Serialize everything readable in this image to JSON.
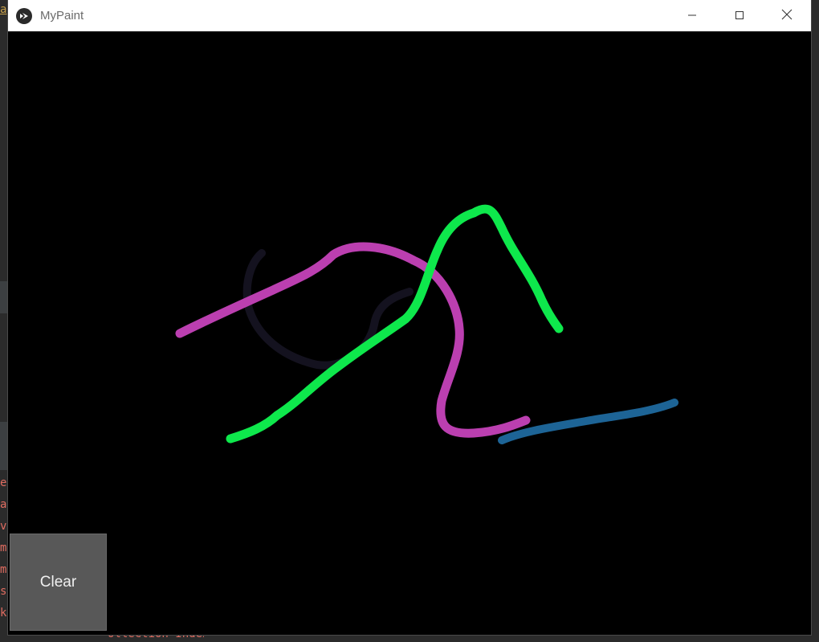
{
  "window": {
    "title": "MyPaint",
    "icon": "kivy-logo-icon"
  },
  "title_bar": {
    "minimize_icon": "minimize-icon",
    "maximize_icon": "maximize-icon",
    "close_icon": "close-icon"
  },
  "canvas": {
    "background": "#000000",
    "strokes": [
      {
        "name": "dark-navy-stroke",
        "color": "#14121f"
      },
      {
        "name": "magenta-stroke",
        "color": "#bb3fb0"
      },
      {
        "name": "green-stroke",
        "color": "#0ee84c"
      },
      {
        "name": "blue-stroke",
        "color": "#1d6496"
      }
    ]
  },
  "toolbar": {
    "clear_label": "Clear"
  },
  "background_editor": {
    "top_fragment": "a",
    "side_fragments": [
      "er",
      "ar",
      "ve",
      "ma",
      "ma",
      " s",
      "ke"
    ],
    "bottom_fragment": "olleCtion Index  Step"
  }
}
